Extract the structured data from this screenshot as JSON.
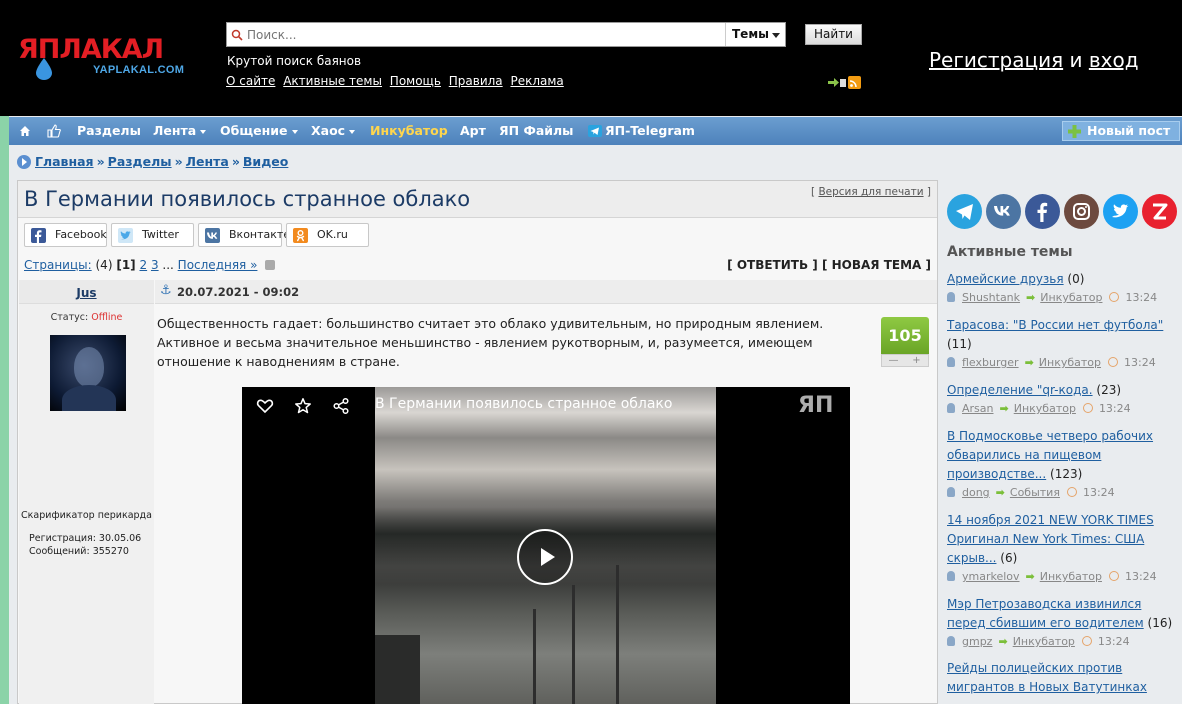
{
  "header": {
    "logo_main": "ЯПЛАКАЛ",
    "logo_sub": "YAPLAKAL.COM",
    "search_placeholder": "Поиск...",
    "search_scope": "Темы",
    "search_button": "Найти",
    "tagline": "Крутой поиск баянов",
    "links": [
      "О сайте",
      "Активные темы",
      "Помощь",
      "Правила",
      "Реклама"
    ],
    "register": "Регистрация",
    "and": "и",
    "login": "вход"
  },
  "nav": {
    "items": [
      {
        "label": "Разделы"
      },
      {
        "label": "Лента"
      },
      {
        "label": "Общение"
      },
      {
        "label": "Хаос"
      },
      {
        "label": "Инкубатор"
      },
      {
        "label": "Арт"
      },
      {
        "label": "ЯП Файлы"
      },
      {
        "label": "ЯП-Telegram"
      }
    ],
    "new_post": "Новый пост"
  },
  "breadcrumb": [
    "Главная",
    "Разделы",
    "Лента",
    "Видео"
  ],
  "post": {
    "title": "В Германии появилось странное облако",
    "print": "Версия для печати",
    "share": [
      "Facebook",
      "Twitter",
      "Вконтакте",
      "OK.ru"
    ],
    "pager_label": "Страницы:",
    "pager_total": "(4)",
    "pager_current": "[1]",
    "pager_pages": [
      "2",
      "3"
    ],
    "pager_last": "Последняя »",
    "reply": "[ ОТВЕТИТЬ ]",
    "new_topic": "[ НОВАЯ ТЕМА ]",
    "date": "20.07.2021 - 09:02",
    "text": "Общественность гадает: большинство считает это облако удивительным, но природным явлением. Активное и весьма значительное меньшинство - явлением рукотворным, и, разумеется, имеющем отношение к наводнениям в стране.",
    "rating": "105",
    "rating_minus": "—",
    "rating_plus": "+",
    "video_title": "В Германии появилось странное облако",
    "video_watermark": "ЯП"
  },
  "author": {
    "name": "Jus",
    "status_label": "Статус:",
    "status": "Offline",
    "rank": "Скарификатор перикарда",
    "registration": "Регистрация: 30.05.06",
    "messages": "Сообщений: 355270"
  },
  "sidebar": {
    "title": "Активные темы",
    "social": [
      "telegram",
      "vk",
      "facebook",
      "instagram",
      "twitter",
      "zen"
    ],
    "topics": [
      {
        "title": "Армейские друзья",
        "count": "(0)",
        "user": "Shushtank",
        "section": "Инкубатор",
        "time": "13:24"
      },
      {
        "title": "Тарасова: \"В России нет футбола\"",
        "count": "(11)",
        "user": "flexburger",
        "section": "Инкубатор",
        "time": "13:24"
      },
      {
        "title": "Определение \"qr-кода.",
        "count": "(23)",
        "user": "Arsan",
        "section": "Инкубатор",
        "time": "13:24"
      },
      {
        "title": "В Подмосковье четверо рабочих обварились на пищевом производстве...",
        "count": "(123)",
        "user": "dong",
        "section": "События",
        "time": "13:24"
      },
      {
        "title": "14 ноября 2021 NEW YORK TIMES Оригинал New York Times: США скрыв...",
        "count": "(6)",
        "user": "ymarkelov",
        "section": "Инкубатор",
        "time": "13:24"
      },
      {
        "title": "Мэр Петрозаводска извинился перед сбившим его водителем",
        "count": "(16)",
        "user": "gmpz",
        "section": "Инкубатор",
        "time": "13:24"
      },
      {
        "title": "Рейды полицейских против мигрантов в Новых Ватутинках",
        "count": "",
        "user": "",
        "section": "",
        "time": ""
      }
    ]
  },
  "colors": {
    "header_bg": "#000000",
    "nav_bg": "#5a8fc8",
    "link": "#1f5fa0",
    "rating_green": "#7cb733",
    "accent_yellow": "#ffd64d"
  }
}
